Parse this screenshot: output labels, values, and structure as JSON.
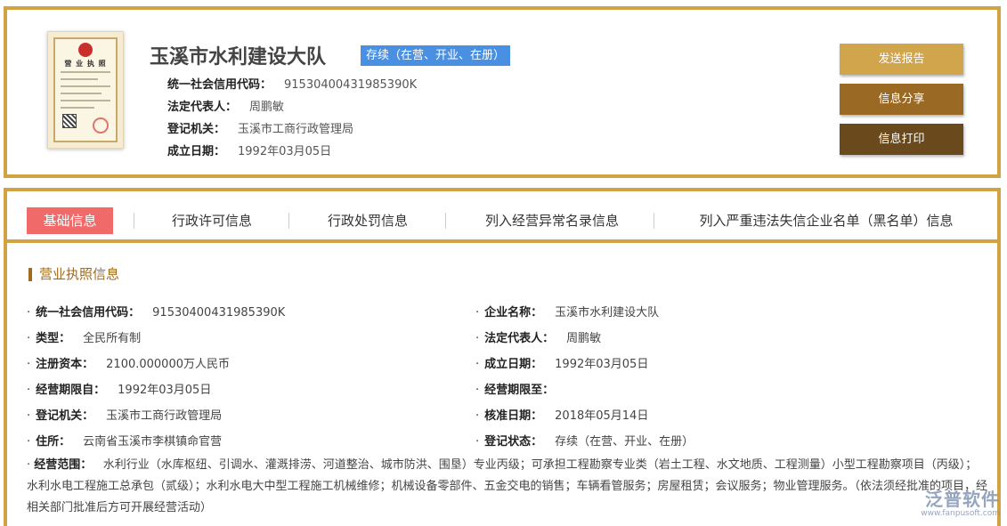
{
  "header": {
    "company_name": "玉溪市水利建设大队",
    "status": "存续（在营、开业、在册）",
    "rows": [
      {
        "label": "统一社会信用代码：",
        "value": "91530400431985390K"
      },
      {
        "label": "法定代表人：",
        "value": "周鹏敏"
      },
      {
        "label": "登记机关：",
        "value": "玉溪市工商行政管理局"
      },
      {
        "label": "成立日期：",
        "value": "1992年03月05日"
      }
    ],
    "license_image": {
      "title": "营 业 执 照"
    }
  },
  "actions": {
    "send_report": "发送报告",
    "share": "信息分享",
    "print": "信息打印"
  },
  "tabs": [
    {
      "label": "基础信息",
      "active": true
    },
    {
      "label": "行政许可信息",
      "active": false
    },
    {
      "label": "行政处罚信息",
      "active": false
    },
    {
      "label": "列入经营异常名录信息",
      "active": false
    },
    {
      "label": "列入严重违法失信企业名单（黑名单）信息",
      "active": false
    }
  ],
  "section": {
    "title": "营业执照信息",
    "left": [
      {
        "label": "统一社会信用代码：",
        "value": "91530400431985390K"
      },
      {
        "label": "类型：",
        "value": "全民所有制"
      },
      {
        "label": "注册资本：",
        "value": "2100.000000万人民币"
      },
      {
        "label": "经营期限自：",
        "value": "1992年03月05日"
      },
      {
        "label": "登记机关：",
        "value": "玉溪市工商行政管理局"
      },
      {
        "label": "住所：",
        "value": "云南省玉溪市李棋镇命官营"
      }
    ],
    "right": [
      {
        "label": "企业名称：",
        "value": "玉溪市水利建设大队"
      },
      {
        "label": "法定代表人：",
        "value": "周鹏敏"
      },
      {
        "label": "成立日期：",
        "value": "1992年03月05日"
      },
      {
        "label": "经营期限至：",
        "value": ""
      },
      {
        "label": "核准日期：",
        "value": "2018年05月14日"
      },
      {
        "label": "登记状态：",
        "value": "存续（在营、开业、在册）"
      }
    ],
    "scope": {
      "label": "经营范围：",
      "value": "水利行业（水库枢纽、引调水、灌溉排涝、河道整治、城市防洪、围垦）专业丙级；可承担工程勘察专业类（岩土工程、水文地质、工程测量）小型工程勘察项目（丙级）；水利水电工程施工总承包（贰级）；水利水电大中型工程施工机械维修；机械设备零部件、五金交电的销售；车辆看管服务；房屋租赁；会议服务；物业管理服务。（依法须经批准的项目，经相关部门批准后方可开展经营活动）"
    }
  },
  "watermark": {
    "brand": "泛普软件",
    "url": "www.fanpusoft.com"
  },
  "colors": {
    "accent": "#d1a343",
    "active_tab": "#f16a6a",
    "status_badge": "#4a90e2"
  }
}
